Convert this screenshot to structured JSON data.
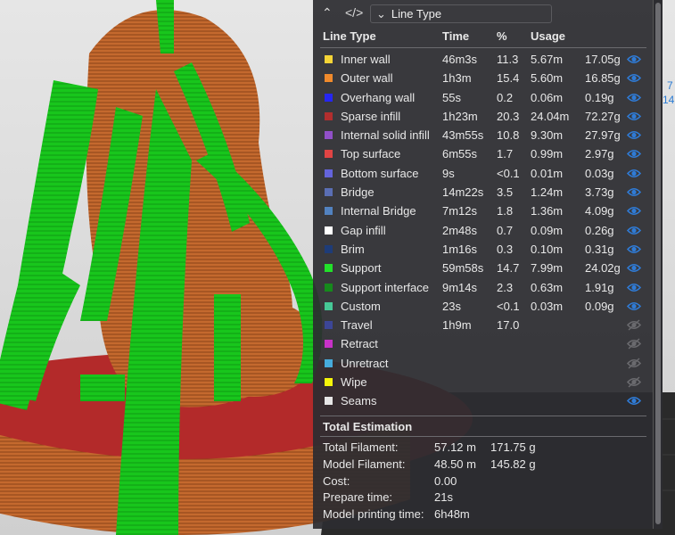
{
  "colors": {
    "panel_bg": "#2c2c30",
    "accent": "#2f7bd6",
    "support_green": "#16c51a",
    "model_orange": "#c0652d",
    "plate_red": "#b02828"
  },
  "toolbar": {
    "collapse_icon": "double-chevron-up-icon",
    "code_icon": "code-brackets-icon",
    "view_type": "Line Type"
  },
  "side_numbers": [
    "7",
    "14"
  ],
  "table": {
    "headers": {
      "type": "Line Type",
      "time": "Time",
      "percent": "%",
      "usage": "Usage"
    },
    "rows": [
      {
        "name": "Inner wall",
        "color": "#f5d436",
        "time": "46m3s",
        "percent": "11.3",
        "length": "5.67m",
        "weight": "17.05g",
        "visible": true
      },
      {
        "name": "Outer wall",
        "color": "#f08a2c",
        "time": "1h3m",
        "percent": "15.4",
        "length": "5.60m",
        "weight": "16.85g",
        "visible": true
      },
      {
        "name": "Overhang wall",
        "color": "#2626f2",
        "time": "55s",
        "percent": "0.2",
        "length": "0.06m",
        "weight": "0.19g",
        "visible": true
      },
      {
        "name": "Sparse infill",
        "color": "#b22e2e",
        "time": "1h23m",
        "percent": "20.3",
        "length": "24.04m",
        "weight": "72.27g",
        "visible": true
      },
      {
        "name": "Internal solid infill",
        "color": "#9150c8",
        "time": "43m55s",
        "percent": "10.8",
        "length": "9.30m",
        "weight": "27.97g",
        "visible": true
      },
      {
        "name": "Top surface",
        "color": "#e04444",
        "time": "6m55s",
        "percent": "1.7",
        "length": "0.99m",
        "weight": "2.97g",
        "visible": true
      },
      {
        "name": "Bottom surface",
        "color": "#6464dc",
        "time": "9s",
        "percent": "<0.1",
        "length": "0.01m",
        "weight": "0.03g",
        "visible": true
      },
      {
        "name": "Bridge",
        "color": "#5a6eb4",
        "time": "14m22s",
        "percent": "3.5",
        "length": "1.24m",
        "weight": "3.73g",
        "visible": true
      },
      {
        "name": "Internal Bridge",
        "color": "#5282c0",
        "time": "7m12s",
        "percent": "1.8",
        "length": "1.36m",
        "weight": "4.09g",
        "visible": true
      },
      {
        "name": "Gap infill",
        "color": "#ffffff",
        "time": "2m48s",
        "percent": "0.7",
        "length": "0.09m",
        "weight": "0.26g",
        "visible": true
      },
      {
        "name": "Brim",
        "color": "#1e3c78",
        "time": "1m16s",
        "percent": "0.3",
        "length": "0.10m",
        "weight": "0.31g",
        "visible": true
      },
      {
        "name": "Support",
        "color": "#22e02a",
        "time": "59m58s",
        "percent": "14.7",
        "length": "7.99m",
        "weight": "24.02g",
        "visible": true
      },
      {
        "name": "Support interface",
        "color": "#168a1c",
        "time": "9m14s",
        "percent": "2.3",
        "length": "0.63m",
        "weight": "1.91g",
        "visible": true
      },
      {
        "name": "Custom",
        "color": "#46c896",
        "time": "23s",
        "percent": "<0.1",
        "length": "0.03m",
        "weight": "0.09g",
        "visible": true
      },
      {
        "name": "Travel",
        "color": "#3c4696",
        "time": "1h9m",
        "percent": "17.0",
        "length": "",
        "weight": "",
        "visible": false
      },
      {
        "name": "Retract",
        "color": "#c832c8",
        "time": "",
        "percent": "",
        "length": "",
        "weight": "",
        "visible": false
      },
      {
        "name": "Unretract",
        "color": "#46aadc",
        "time": "",
        "percent": "",
        "length": "",
        "weight": "",
        "visible": false
      },
      {
        "name": "Wipe",
        "color": "#f5f50a",
        "time": "",
        "percent": "",
        "length": "",
        "weight": "",
        "visible": false
      },
      {
        "name": "Seams",
        "color": "#e6e6e6",
        "time": "",
        "percent": "",
        "length": "",
        "weight": "",
        "visible": true
      }
    ]
  },
  "totals": {
    "title": "Total Estimation",
    "rows": [
      {
        "label": "Total Filament:",
        "v1": "57.12 m",
        "v2": "171.75 g"
      },
      {
        "label": "Model Filament:",
        "v1": "48.50 m",
        "v2": "145.82 g"
      },
      {
        "label": "Cost:",
        "v1": "0.00",
        "v2": ""
      },
      {
        "label": "Prepare time:",
        "v1": "21s",
        "v2": ""
      },
      {
        "label": "Model printing time:",
        "v1": "6h48m",
        "v2": ""
      }
    ]
  }
}
